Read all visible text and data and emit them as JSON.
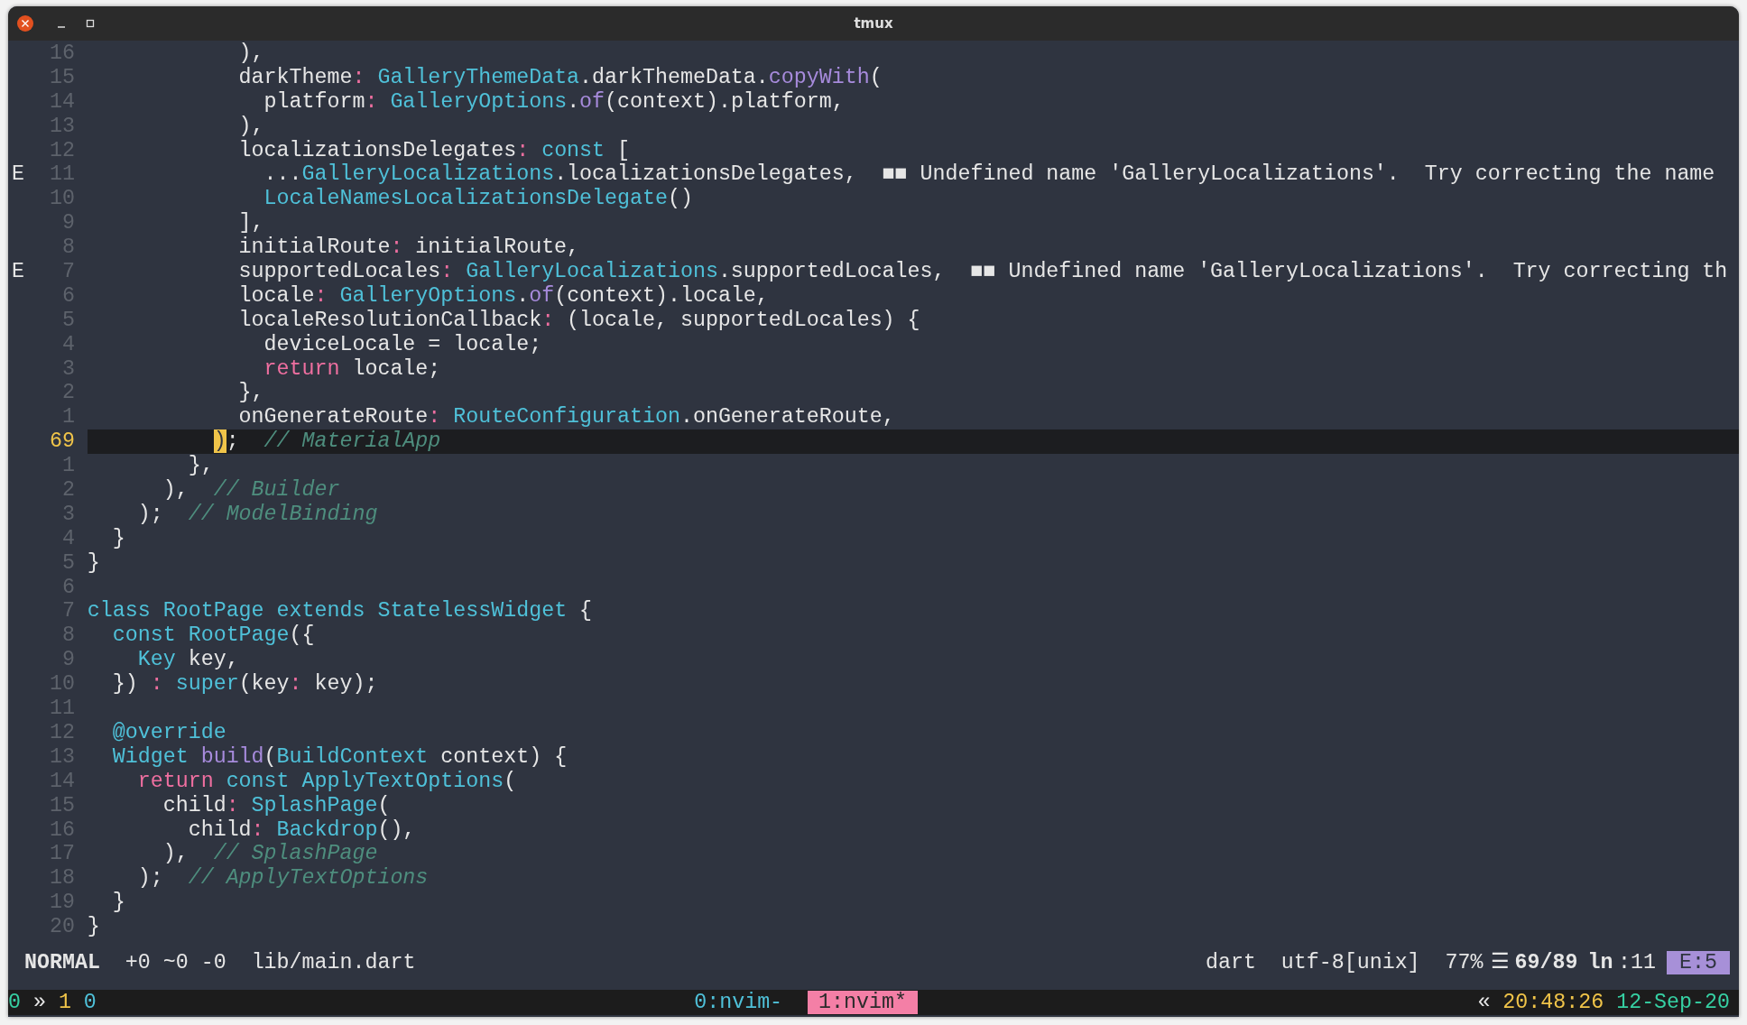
{
  "window": {
    "title": "tmux"
  },
  "editor": {
    "lines": [
      {
        "number": "16",
        "current": false,
        "tokens": [
          {
            "kind": "plain",
            "text": "            ),"
          }
        ]
      },
      {
        "number": "15",
        "current": false,
        "tokens": [
          {
            "kind": "plain",
            "text": "            darkTheme"
          },
          {
            "kind": "operator",
            "text": ":"
          },
          {
            "kind": "type",
            "text": " GalleryThemeData"
          },
          {
            "kind": "plain",
            "text": ".darkThemeData."
          },
          {
            "kind": "function",
            "text": "copyWith"
          },
          {
            "kind": "plain",
            "text": "("
          }
        ]
      },
      {
        "number": "14",
        "current": false,
        "tokens": [
          {
            "kind": "plain",
            "text": "              platform"
          },
          {
            "kind": "operator",
            "text": ":"
          },
          {
            "kind": "type",
            "text": " GalleryOptions"
          },
          {
            "kind": "plain",
            "text": "."
          },
          {
            "kind": "function",
            "text": "of"
          },
          {
            "kind": "plain",
            "text": "(context).platform,"
          }
        ]
      },
      {
        "number": "13",
        "current": false,
        "tokens": [
          {
            "kind": "plain",
            "text": "            ),"
          }
        ]
      },
      {
        "number": "12",
        "current": false,
        "tokens": [
          {
            "kind": "plain",
            "text": "            localizationsDelegates"
          },
          {
            "kind": "operator",
            "text": ":"
          },
          {
            "kind": "type",
            "text": " const"
          },
          {
            "kind": "plain",
            "text": " ["
          }
        ]
      },
      {
        "number": "11",
        "sign": "E",
        "current": false,
        "tokens": [
          {
            "kind": "plain",
            "text": "              ..."
          },
          {
            "kind": "type",
            "text": "GalleryLocalizations"
          },
          {
            "kind": "plain",
            "text": ".localizationsDelegates,"
          }
        ],
        "diagnostic": "■■ Undefined name 'GalleryLocalizations'.  Try correcting the name"
      },
      {
        "number": "10",
        "current": false,
        "tokens": [
          {
            "kind": "type",
            "text": "              LocaleNamesLocalizationsDelegate"
          },
          {
            "kind": "plain",
            "text": "()"
          }
        ]
      },
      {
        "number": "9",
        "current": false,
        "tokens": [
          {
            "kind": "plain",
            "text": "            ],"
          }
        ]
      },
      {
        "number": "8",
        "current": false,
        "tokens": [
          {
            "kind": "plain",
            "text": "            initialRoute"
          },
          {
            "kind": "operator",
            "text": ":"
          },
          {
            "kind": "plain",
            "text": " initialRoute,"
          }
        ]
      },
      {
        "number": "7",
        "sign": "E",
        "current": false,
        "tokens": [
          {
            "kind": "plain",
            "text": "            supportedLocales"
          },
          {
            "kind": "operator",
            "text": ":"
          },
          {
            "kind": "type",
            "text": " GalleryLocalizations"
          },
          {
            "kind": "plain",
            "text": ".supportedLocales,"
          }
        ],
        "diagnostic": "■■ Undefined name 'GalleryLocalizations'.  Try correcting th"
      },
      {
        "number": "6",
        "current": false,
        "tokens": [
          {
            "kind": "plain",
            "text": "            locale"
          },
          {
            "kind": "operator",
            "text": ":"
          },
          {
            "kind": "type",
            "text": " GalleryOptions"
          },
          {
            "kind": "plain",
            "text": "."
          },
          {
            "kind": "function",
            "text": "of"
          },
          {
            "kind": "plain",
            "text": "(context).locale,"
          }
        ]
      },
      {
        "number": "5",
        "current": false,
        "tokens": [
          {
            "kind": "plain",
            "text": "            localeResolutionCallback"
          },
          {
            "kind": "operator",
            "text": ":"
          },
          {
            "kind": "plain",
            "text": " (locale, supportedLocales) {"
          }
        ]
      },
      {
        "number": "4",
        "current": false,
        "tokens": [
          {
            "kind": "plain",
            "text": "              deviceLocale = locale;"
          }
        ]
      },
      {
        "number": "3",
        "current": false,
        "tokens": [
          {
            "kind": "operator",
            "text": "              return"
          },
          {
            "kind": "plain",
            "text": " locale;"
          }
        ]
      },
      {
        "number": "2",
        "current": false,
        "tokens": [
          {
            "kind": "plain",
            "text": "            },"
          }
        ]
      },
      {
        "number": "1",
        "current": false,
        "tokens": [
          {
            "kind": "plain",
            "text": "            onGenerateRoute"
          },
          {
            "kind": "operator",
            "text": ":"
          },
          {
            "kind": "type",
            "text": " RouteConfiguration"
          },
          {
            "kind": "plain",
            "text": ".onGenerateRoute,"
          }
        ]
      },
      {
        "number": "69",
        "current": true,
        "tokens": [
          {
            "kind": "cursor",
            "text": "          )"
          },
          {
            "kind": "plain",
            "text": ";"
          },
          {
            "kind": "comment",
            "text": "  // MaterialApp"
          }
        ]
      },
      {
        "number": "1",
        "current": false,
        "tokens": [
          {
            "kind": "plain",
            "text": "        },"
          }
        ]
      },
      {
        "number": "2",
        "current": false,
        "tokens": [
          {
            "kind": "plain",
            "text": "      ),"
          },
          {
            "kind": "comment",
            "text": "  // Builder"
          }
        ]
      },
      {
        "number": "3",
        "current": false,
        "tokens": [
          {
            "kind": "plain",
            "text": "    );"
          },
          {
            "kind": "comment",
            "text": "  // ModelBinding"
          }
        ]
      },
      {
        "number": "4",
        "current": false,
        "tokens": [
          {
            "kind": "plain",
            "text": "  }"
          }
        ]
      },
      {
        "number": "5",
        "current": false,
        "tokens": [
          {
            "kind": "plain",
            "text": "}"
          }
        ]
      },
      {
        "number": "6",
        "current": false
      },
      {
        "number": "7",
        "current": false,
        "tokens": [
          {
            "kind": "type",
            "text": "class RootPage extends StatelessWidget"
          },
          {
            "kind": "plain",
            "text": " {"
          }
        ]
      },
      {
        "number": "8",
        "current": false,
        "tokens": [
          {
            "kind": "type",
            "text": "  const RootPage"
          },
          {
            "kind": "plain",
            "text": "({"
          }
        ]
      },
      {
        "number": "9",
        "current": false,
        "tokens": [
          {
            "kind": "type",
            "text": "    Key"
          },
          {
            "kind": "plain",
            "text": " key,"
          }
        ]
      },
      {
        "number": "10",
        "current": false,
        "tokens": [
          {
            "kind": "plain",
            "text": "  })"
          },
          {
            "kind": "operator",
            "text": " :"
          },
          {
            "kind": "type",
            "text": " super"
          },
          {
            "kind": "plain",
            "text": "(key"
          },
          {
            "kind": "operator",
            "text": ":"
          },
          {
            "kind": "plain",
            "text": " key);"
          }
        ]
      },
      {
        "number": "11",
        "current": false
      },
      {
        "number": "12",
        "current": false,
        "tokens": [
          {
            "kind": "type",
            "text": "  @override"
          }
        ]
      },
      {
        "number": "13",
        "current": false,
        "tokens": [
          {
            "kind": "type",
            "text": "  Widget"
          },
          {
            "kind": "function",
            "text": " build"
          },
          {
            "kind": "plain",
            "text": "("
          },
          {
            "kind": "type",
            "text": "BuildContext"
          },
          {
            "kind": "plain",
            "text": " context) {"
          }
        ]
      },
      {
        "number": "14",
        "current": false,
        "tokens": [
          {
            "kind": "operator",
            "text": "    return"
          },
          {
            "kind": "type",
            "text": " const ApplyTextOptions"
          },
          {
            "kind": "plain",
            "text": "("
          }
        ]
      },
      {
        "number": "15",
        "current": false,
        "tokens": [
          {
            "kind": "plain",
            "text": "      child"
          },
          {
            "kind": "operator",
            "text": ":"
          },
          {
            "kind": "type",
            "text": " SplashPage"
          },
          {
            "kind": "plain",
            "text": "("
          }
        ]
      },
      {
        "number": "16",
        "current": false,
        "tokens": [
          {
            "kind": "plain",
            "text": "        child"
          },
          {
            "kind": "operator",
            "text": ":"
          },
          {
            "kind": "type",
            "text": " Backdrop"
          },
          {
            "kind": "plain",
            "text": "(),"
          }
        ]
      },
      {
        "number": "17",
        "current": false,
        "tokens": [
          {
            "kind": "plain",
            "text": "      ),"
          },
          {
            "kind": "comment",
            "text": "  // SplashPage"
          }
        ]
      },
      {
        "number": "18",
        "current": false,
        "tokens": [
          {
            "kind": "plain",
            "text": "    );"
          },
          {
            "kind": "comment",
            "text": "  // ApplyTextOptions"
          }
        ]
      },
      {
        "number": "19",
        "current": false,
        "tokens": [
          {
            "kind": "plain",
            "text": "  }"
          }
        ]
      },
      {
        "number": "20",
        "current": false,
        "tokens": [
          {
            "kind": "plain",
            "text": "}"
          }
        ]
      }
    ]
  },
  "status_line": {
    "mode": "NORMAL",
    "git": "+0 ~0 -0",
    "file": "lib/main.dart",
    "filetype": "dart",
    "encoding": "utf-8[unix]",
    "percent": "77%",
    "lines_glyph": "☰",
    "position": "69/89",
    "ln_glyph": "ln",
    "column": ":11",
    "errors": "E:5"
  },
  "tmux_bar": {
    "session": [
      {
        "kind": "green",
        "text": "0"
      },
      {
        "kind": "white",
        "text": "»"
      },
      {
        "kind": "yellow",
        "text": "1"
      },
      {
        "kind": "cyan",
        "text": "0"
      }
    ],
    "windows": [
      {
        "label": "0:nvim-",
        "selected": false
      },
      {
        "label": "1:nvim*",
        "selected": true
      }
    ],
    "right": [
      {
        "kind": "white",
        "text": "«"
      },
      {
        "kind": "yellow",
        "text": "20:48:26"
      },
      {
        "kind": "green",
        "text": "12-Sep-20"
      }
    ]
  }
}
